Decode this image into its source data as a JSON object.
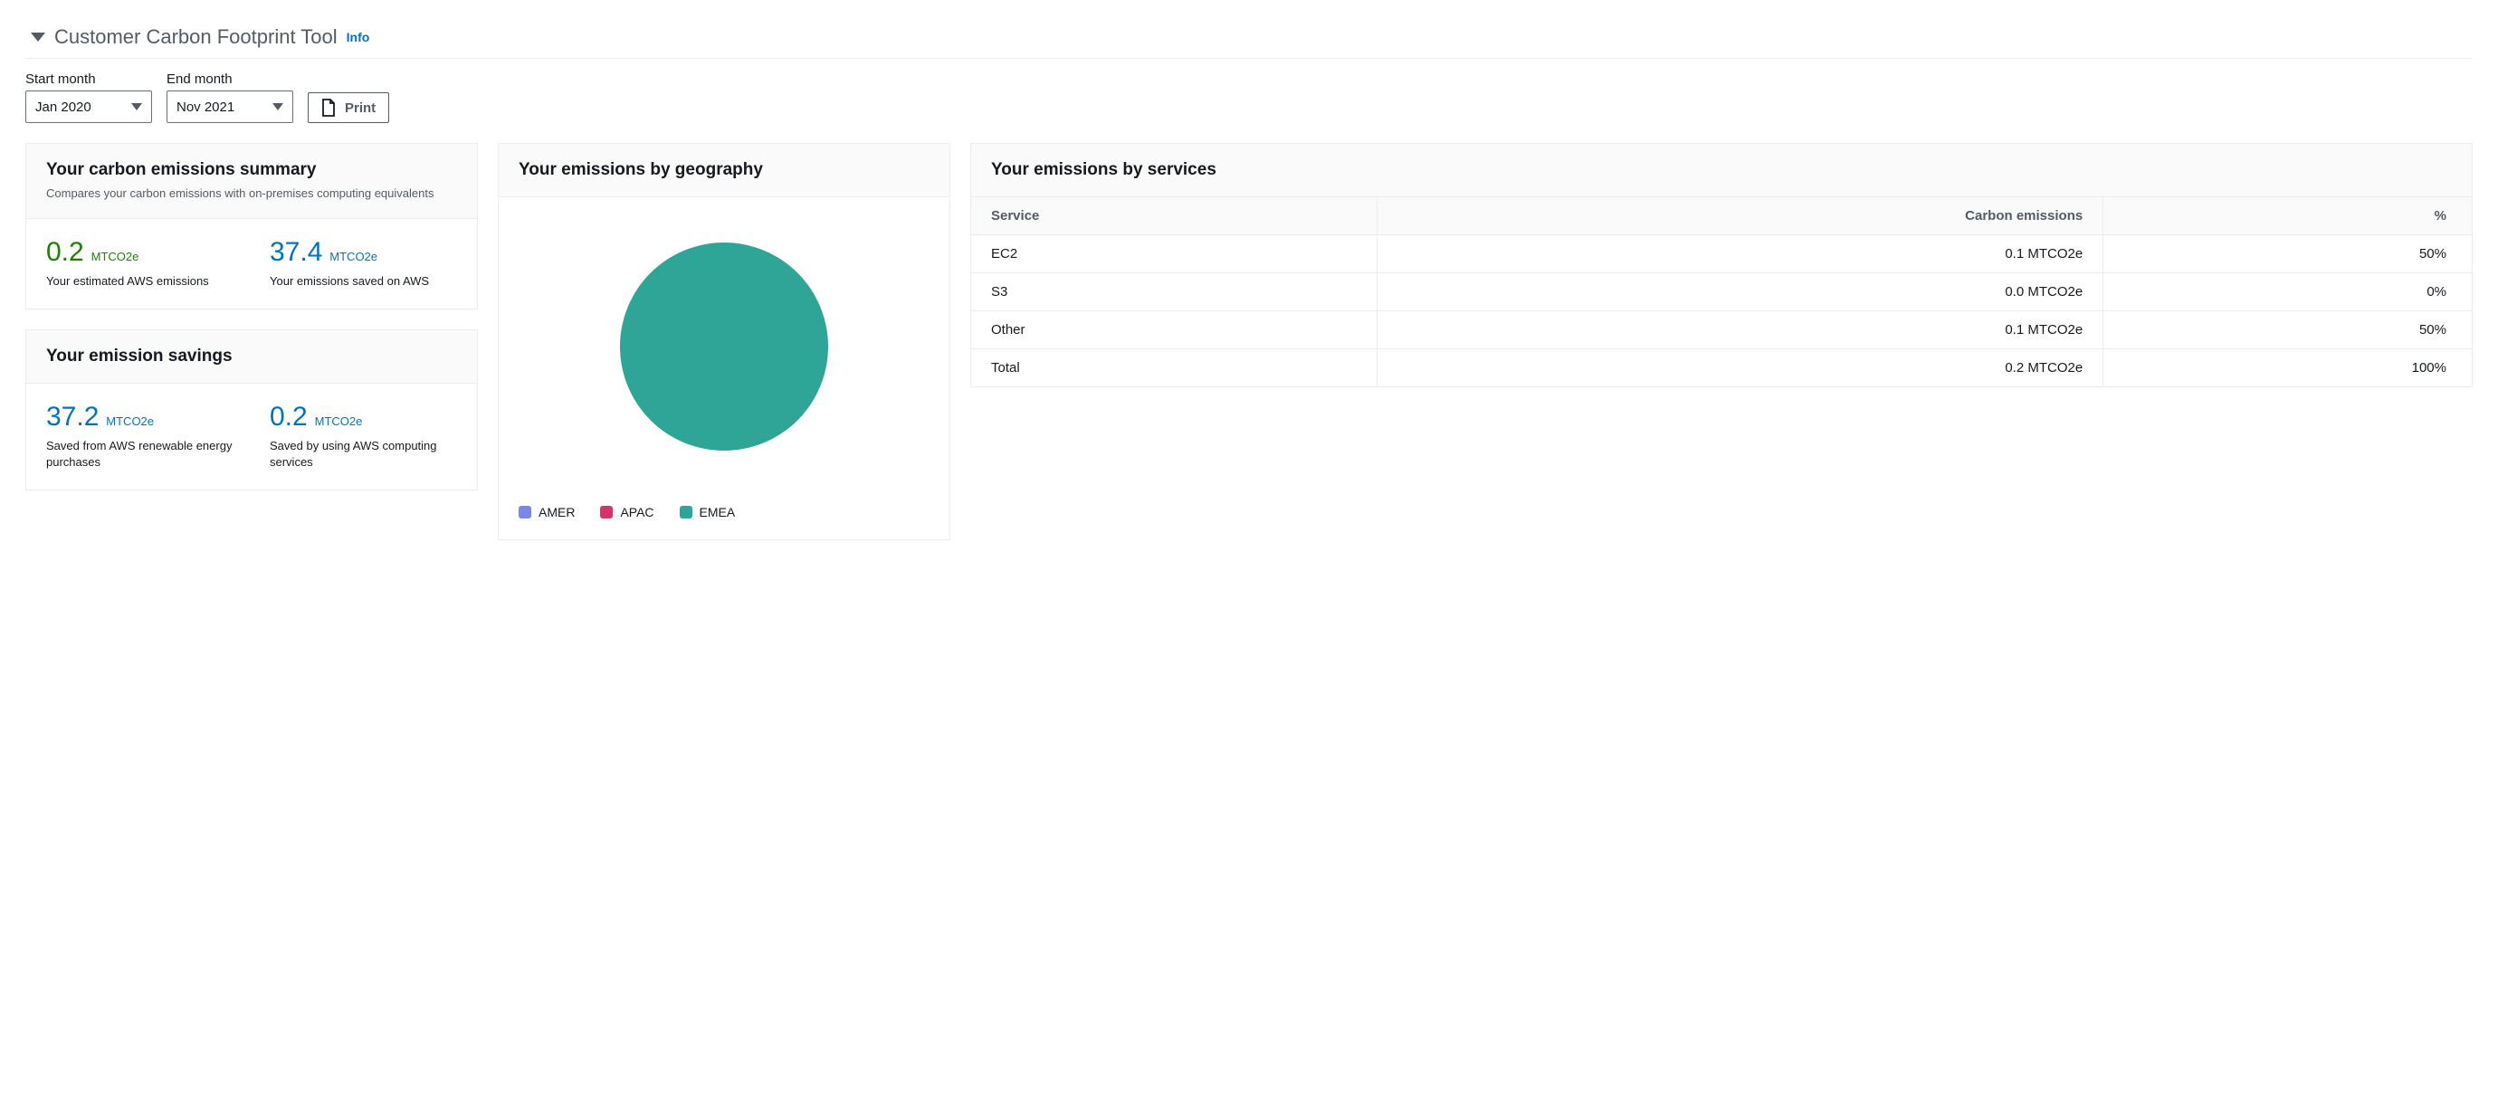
{
  "header": {
    "title": "Customer Carbon Footprint Tool",
    "info_label": "Info"
  },
  "controls": {
    "start_label": "Start month",
    "end_label": "End month",
    "start_value": "Jan 2020",
    "end_value": "Nov 2021",
    "print_label": "Print"
  },
  "summary_card": {
    "title": "Your carbon emissions summary",
    "subtitle": "Compares your carbon emissions with on-premises computing equivalents",
    "estimated": {
      "value": "0.2",
      "unit": "MTCO2e",
      "label": "Your estimated AWS emissions"
    },
    "saved": {
      "value": "37.4",
      "unit": "MTCO2e",
      "label": "Your emissions saved on AWS"
    }
  },
  "savings_card": {
    "title": "Your emission savings",
    "renewable": {
      "value": "37.2",
      "unit": "MTCO2e",
      "label": "Saved from AWS renewable energy purchases"
    },
    "computing": {
      "value": "0.2",
      "unit": "MTCO2e",
      "label": "Saved by using AWS computing services"
    }
  },
  "geography_card": {
    "title": "Your emissions by geography",
    "legend": [
      {
        "name": "AMER",
        "color": "#7a87e6"
      },
      {
        "name": "APAC",
        "color": "#d6336c"
      },
      {
        "name": "EMEA",
        "color": "#2ea597"
      }
    ]
  },
  "services_card": {
    "title": "Your emissions by services",
    "columns": {
      "service": "Service",
      "emissions": "Carbon emissions",
      "percent": "%"
    },
    "rows": [
      {
        "service": "EC2",
        "emissions": "0.1 MTCO2e",
        "percent": "50%"
      },
      {
        "service": "S3",
        "emissions": "0.0 MTCO2e",
        "percent": "0%"
      },
      {
        "service": "Other",
        "emissions": "0.1 MTCO2e",
        "percent": "50%"
      },
      {
        "service": "Total",
        "emissions": "0.2 MTCO2e",
        "percent": "100%"
      }
    ]
  },
  "chart_data": {
    "type": "pie",
    "title": "Your emissions by geography",
    "series": [
      {
        "name": "AMER",
        "value": 0,
        "color": "#7a87e6"
      },
      {
        "name": "APAC",
        "value": 0,
        "color": "#d6336c"
      },
      {
        "name": "EMEA",
        "value": 100,
        "color": "#2ea597"
      }
    ]
  }
}
